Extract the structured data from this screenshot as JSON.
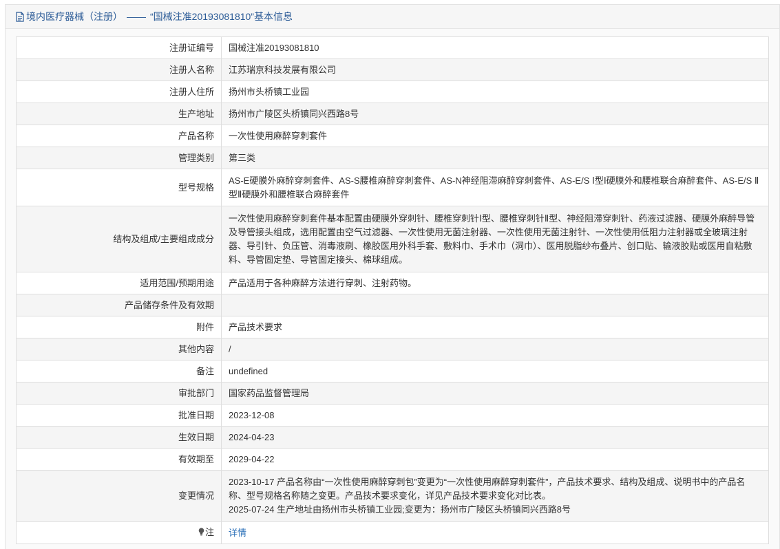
{
  "title": {
    "category": "境内医疗器械（注册）",
    "separator": "——",
    "record": "“国械注准20193081810”基本信息"
  },
  "rows": [
    {
      "label": "注册证编号",
      "value": "国械注准20193081810"
    },
    {
      "label": "注册人名称",
      "value": "江苏瑞京科技发展有限公司"
    },
    {
      "label": "注册人住所",
      "value": "扬州市头桥镇工业园"
    },
    {
      "label": "生产地址",
      "value": "扬州市广陵区头桥镇同兴西路8号"
    },
    {
      "label": "产品名称",
      "value": "一次性使用麻醉穿刺套件"
    },
    {
      "label": "管理类别",
      "value": "第三类"
    },
    {
      "label": "型号规格",
      "value": "AS-E硬膜外麻醉穿刺套件、AS-S腰椎麻醉穿刺套件、AS-N神经阻滞麻醉穿刺套件、AS-E/S Ⅰ型Ⅰ硬膜外和腰椎联合麻醉套件、AS-E/S Ⅱ型Ⅱ硬膜外和腰椎联合麻醉套件"
    },
    {
      "label": "结构及组成/主要组成成分",
      "value": "一次性使用麻醉穿刺套件基本配置由硬膜外穿刺针、腰椎穿刺针Ⅰ型、腰椎穿刺针Ⅱ型、神经阻滞穿刺针、药液过滤器、硬膜外麻醉导管及导管接头组成，选用配置由空气过滤器、一次性使用无菌注射器、一次性使用无菌注射针、一次性使用低阻力注射器或全玻璃注射器、导引针、负压管、消毒液刷、橡胶医用外科手套、敷料巾、手术巾（洞巾）、医用脱脂纱布叠片、创口贴、输液胶贴或医用自粘敷料、导管固定垫、导管固定接头、棉球组成。"
    },
    {
      "label": "适用范围/预期用途",
      "value": "产品适用于各种麻醉方法进行穿刺、注射药物。"
    },
    {
      "label": "产品储存条件及有效期",
      "value": ""
    },
    {
      "label": "附件",
      "value": "产品技术要求"
    },
    {
      "label": "其他内容",
      "value": "/"
    },
    {
      "label": "备注",
      "value": "undefined"
    },
    {
      "label": "审批部门",
      "value": "国家药品监督管理局"
    },
    {
      "label": "批准日期",
      "value": "2023-12-08"
    },
    {
      "label": "生效日期",
      "value": "2024-04-23"
    },
    {
      "label": "有效期至",
      "value": "2029-04-22"
    }
  ],
  "change": {
    "label": "变更情况",
    "line1": "2023-10-17 产品名称由“一次性使用麻醉穿刺包”变更为“一次性使用麻醉穿刺套件”，产品技术要求、结构及组成、说明书中的产品名称、型号规格名称随之变更。产品技术要求变化，详见产品技术要求变化对比表。",
    "line2": "2025-07-24 生产地址由扬州市头桥镇工业园;变更为：扬州市广陵区头桥镇同兴西路8号"
  },
  "note": {
    "label": "注",
    "link_text": "详情",
    "icon": "lightbulb-icon"
  }
}
